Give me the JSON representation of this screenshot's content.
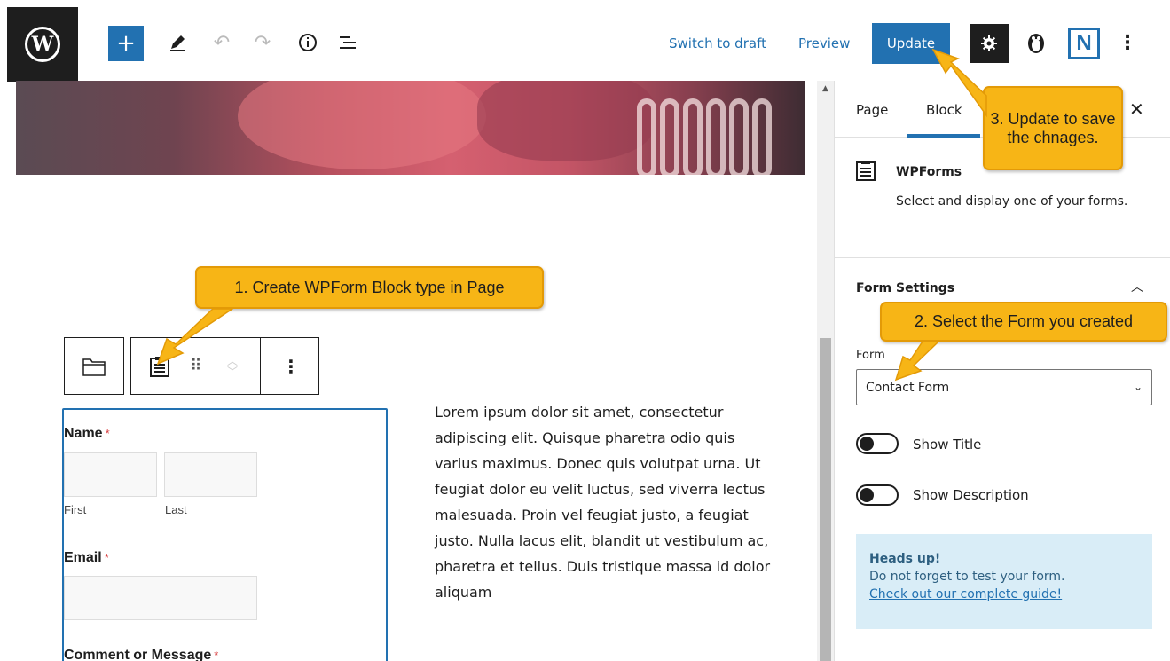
{
  "toolbar": {
    "add_icon": "plus-icon",
    "switch_to_draft": "Switch to draft",
    "preview": "Preview",
    "update": "Update",
    "more_icon": "vertical-ellipsis-icon",
    "n_logo": "N"
  },
  "form_preview": {
    "name_label": "Name",
    "required_mark": "*",
    "first_sub": "First",
    "last_sub": "Last",
    "email_label": "Email",
    "comment_label": "Comment or Message"
  },
  "lorem_text": "Lorem ipsum dolor sit amet, consectetur adipiscing elit. Quisque pharetra odio quis varius maximus. Donec quis volutpat urna. Ut feugiat dolor eu velit luctus, sed viverra lectus malesuada. Proin vel feugiat justo, a feugiat justo. Nulla lacus elit, blandit ut vestibulum ac, pharetra et tellus. Duis tristique massa id dolor aliquam",
  "sidebar": {
    "tabs": [
      {
        "label": "Page"
      },
      {
        "label": "Block"
      }
    ],
    "block_card": {
      "title": "WPForms",
      "description": "Select and display one of your forms."
    },
    "form_settings": {
      "title": "Form Settings",
      "form_label": "Form",
      "selected_form": "Contact Form",
      "show_title_label": "Show Title",
      "show_description_label": "Show Description"
    },
    "heads_up": {
      "title": "Heads up!",
      "text": "Do not forget to test your form.",
      "link": "Check out our complete guide!"
    }
  },
  "callouts": {
    "step1": "1. Create WPForm Block type in Page",
    "step2": "2. Select the Form you created",
    "step3": "3. Update to save the chnages."
  },
  "colors": {
    "accent": "#2271b1",
    "callout": "#f7b516",
    "heads_up_bg": "#d9edf7"
  }
}
